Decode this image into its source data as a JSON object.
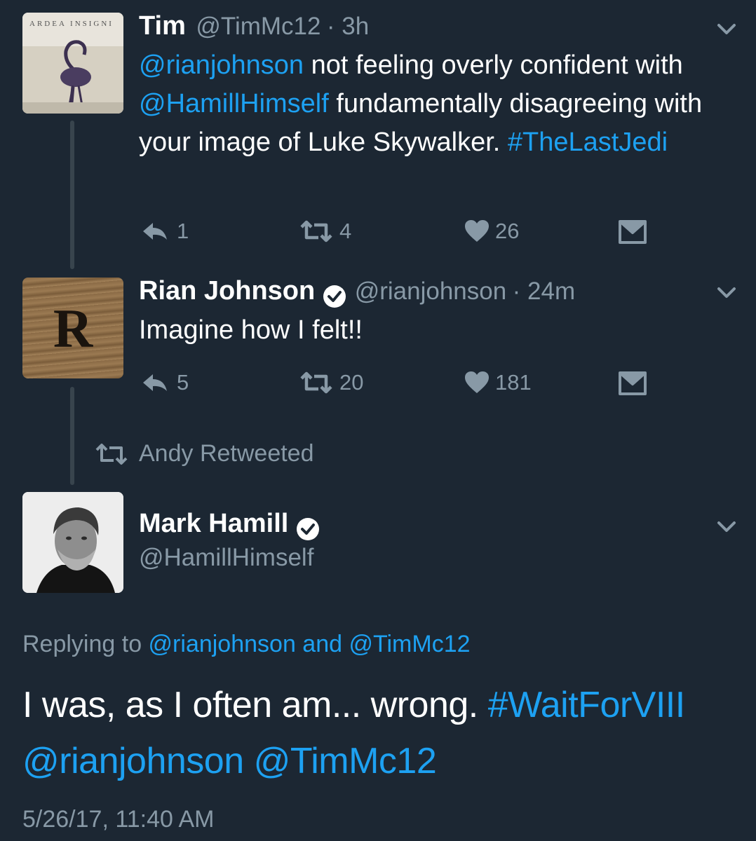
{
  "colors": {
    "background": "#1c2733",
    "accent": "#1da1f2",
    "muted": "#8899a6",
    "text": "#ffffff"
  },
  "tweet1": {
    "name": "Tim",
    "handle": "@TimMc12",
    "time": "· 3h",
    "avatar_text": "ARDEA INSIGNI",
    "text_parts": {
      "mention1": "@rianjohnson",
      "t1": " not feeling overly confident with ",
      "mention2": "@HamillHimself",
      "t2": " fundamentally disagreeing with your image of Luke Skywalker. ",
      "hashtag": "#TheLastJedi"
    },
    "replies": "1",
    "retweets": "4",
    "likes": "26"
  },
  "tweet2": {
    "name": "Rian Johnson",
    "handle": "@rianjohnson",
    "time": "· 24m",
    "avatar_letter": "R",
    "text": "Imagine how I felt!!",
    "replies": "5",
    "retweets": "20",
    "likes": "181"
  },
  "retweet_context": {
    "label": "Andy Retweeted"
  },
  "tweet3": {
    "name": "Mark Hamill",
    "handle": "@HamillHimself",
    "replying_prefix": "Replying to ",
    "replying_to_1": "@rianjohnson",
    "replying_and": " and ",
    "replying_to_2": "@TimMc12",
    "text_main": "I was, as I often am... wrong. ",
    "hashtag": "#WaitForVIII",
    "mention1": "@rianjohnson",
    "mention2": "@TimMc12",
    "timestamp": "5/26/17, 11:40 AM"
  },
  "icons": [
    "chevron-down-icon",
    "reply-icon",
    "retweet-icon",
    "heart-icon",
    "message-icon",
    "verified-icon"
  ]
}
